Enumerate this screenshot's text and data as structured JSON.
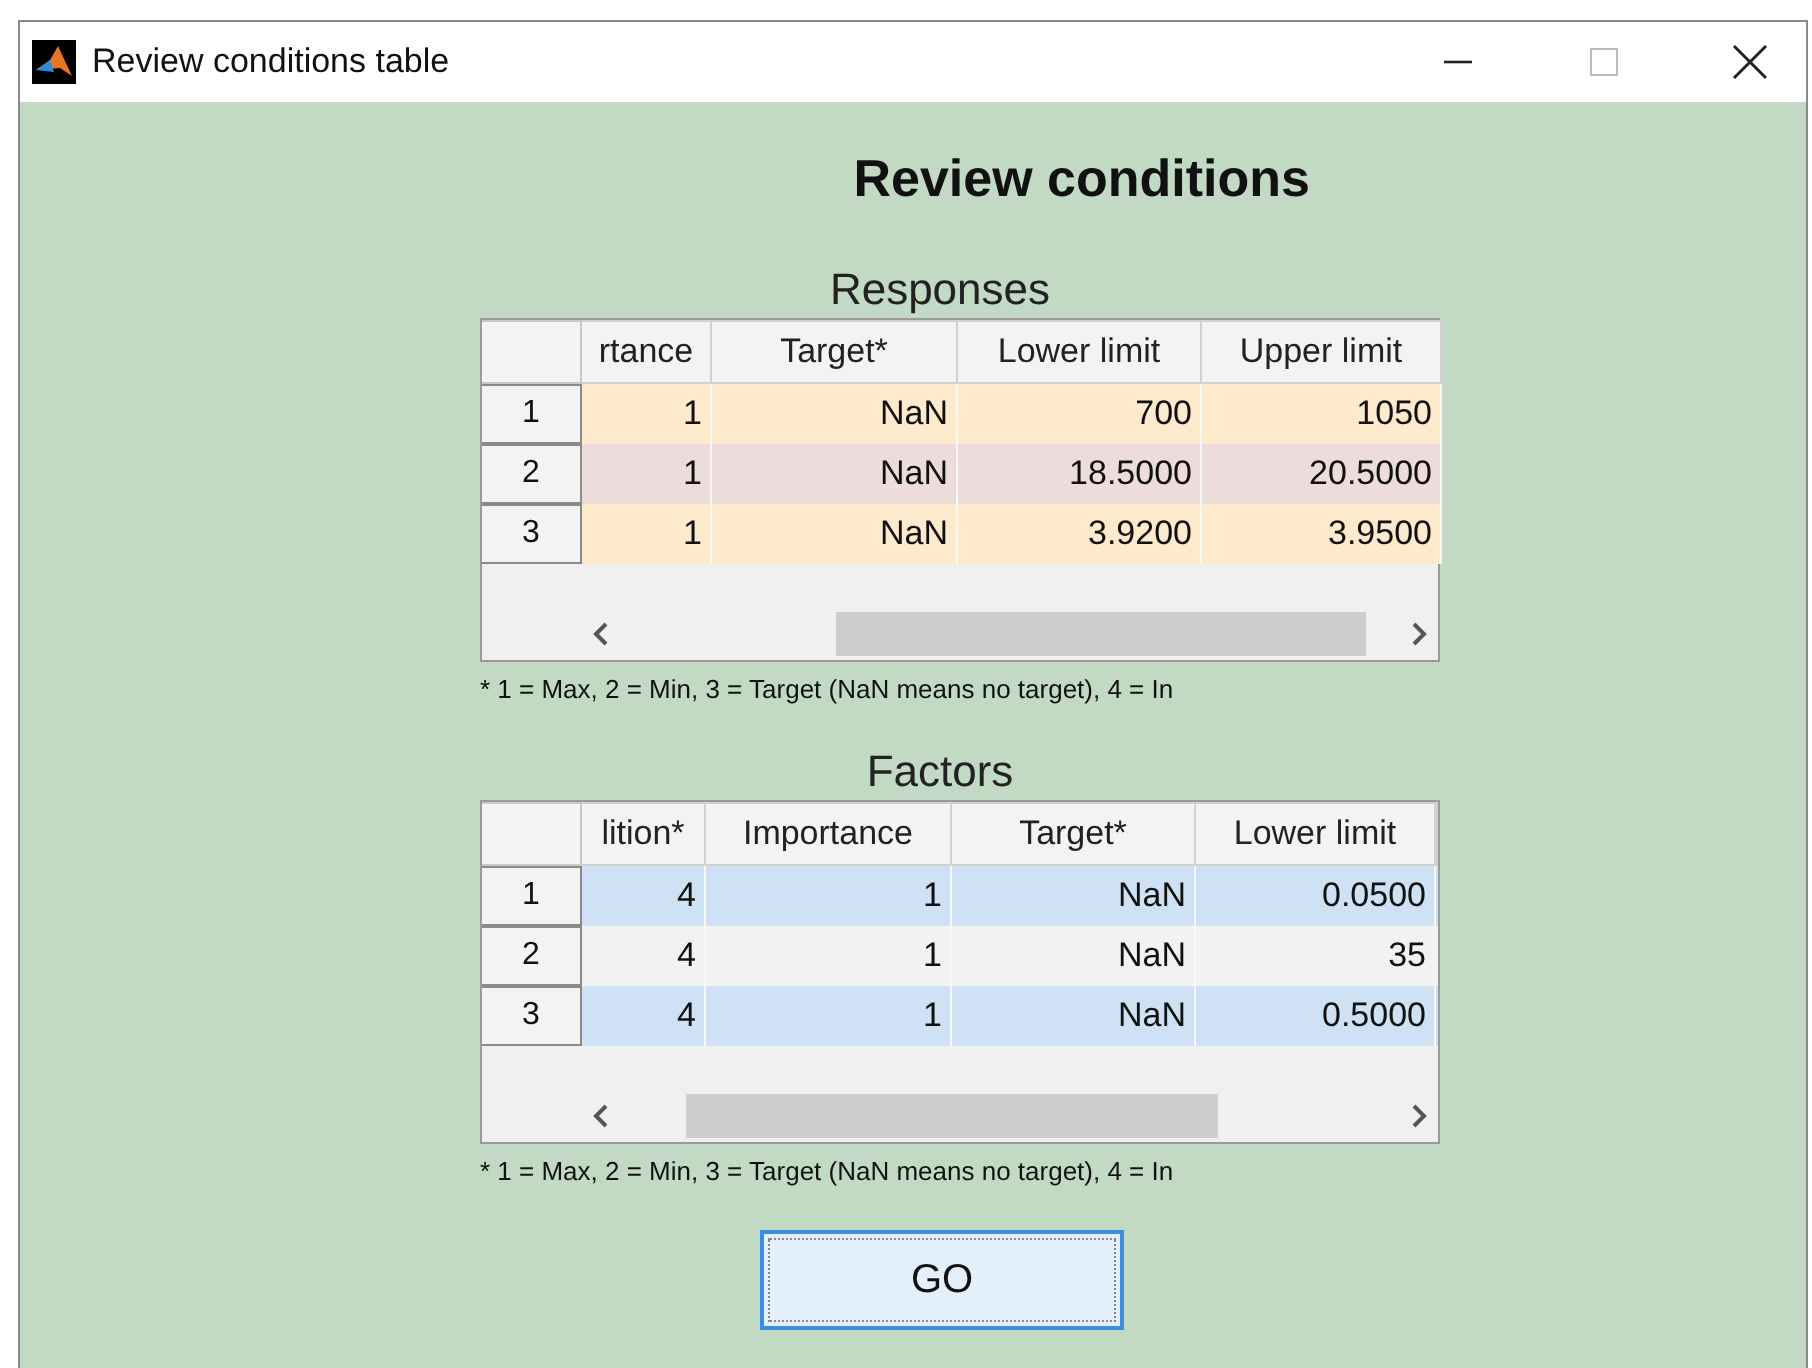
{
  "window": {
    "title": "Review conditions table"
  },
  "heading": "Review conditions",
  "tables": [
    {
      "title": "Responses",
      "columns": [
        "rtance",
        "Target*",
        "Lower limit",
        "Upper limit"
      ],
      "rows": [
        {
          "header": "1",
          "color": "#fde9cc",
          "cells": [
            "1",
            "NaN",
            "700",
            "1050"
          ]
        },
        {
          "header": "2",
          "color": "#eddcdc",
          "cells": [
            "1",
            "NaN",
            "18.5000",
            "20.5000"
          ]
        },
        {
          "header": "3",
          "color": "#fde9cc",
          "cells": [
            "1",
            "NaN",
            "3.9200",
            "3.9500"
          ]
        }
      ],
      "footnote": "* 1 = Max, 2 = Min, 3 = Target (NaN means no target), 4 = In"
    },
    {
      "title": "Factors",
      "columns": [
        "lition*",
        "Importance",
        "Target*",
        "Lower limit"
      ],
      "rows": [
        {
          "header": "1",
          "color": "#cfe1f4",
          "cells": [
            "4",
            "1",
            "NaN",
            "0.0500"
          ]
        },
        {
          "header": "2",
          "color": "#f2f2f2",
          "cells": [
            "4",
            "1",
            "NaN",
            "35"
          ]
        },
        {
          "header": "3",
          "color": "#cfe1f4",
          "cells": [
            "4",
            "1",
            "NaN",
            "0.5000"
          ]
        }
      ],
      "footnote": "* 1 = Max, 2 = Min, 3 = Target (NaN means no target), 4 = In"
    }
  ],
  "button": "GO"
}
